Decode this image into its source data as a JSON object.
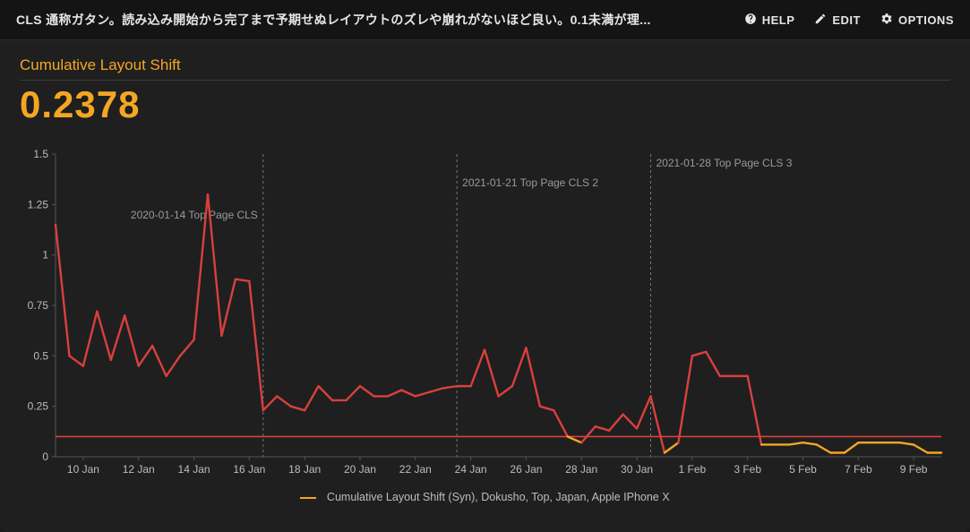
{
  "header": {
    "title_tag": "CLS",
    "title_rest": "通称ガタン。読み込み開始から完了まで予期せぬレイアウトのズレや崩れがないほど良い。0.1未満が理...",
    "help": "HELP",
    "edit": "EDIT",
    "options": "OPTIONS"
  },
  "metric": {
    "title": "Cumulative Layout Shift",
    "value": "0.2378"
  },
  "legend": {
    "series": "Cumulative Layout Shift (Syn), Dokusho, Top, Japan, Apple IPhone X"
  },
  "chart_data": {
    "type": "line",
    "title": "Cumulative Layout Shift",
    "xlabel": "",
    "ylabel": "",
    "ylim": [
      0,
      1.5
    ],
    "y_ticks": [
      0,
      0.25,
      0.5,
      0.75,
      1,
      1.25,
      1.5
    ],
    "x_ticks": [
      "10 Jan",
      "12 Jan",
      "14 Jan",
      "16 Jan",
      "18 Jan",
      "20 Jan",
      "22 Jan",
      "24 Jan",
      "26 Jan",
      "28 Jan",
      "30 Jan",
      "1 Feb",
      "3 Feb",
      "5 Feb",
      "7 Feb",
      "9 Feb"
    ],
    "threshold": 0.1,
    "annotations": [
      {
        "x": 7.5,
        "label": "2020-01-14 Top Page CLS"
      },
      {
        "x": 14.5,
        "label": "2021-01-21 Top Page CLS 2"
      },
      {
        "x": 21.5,
        "label": "2021-01-28 Top Page CLS 3"
      }
    ],
    "series": [
      {
        "name": "Cumulative Layout Shift (Syn), Dokusho, Top, Japan, Apple IPhone X",
        "color": "#f5a623",
        "over_color": "#d8403e",
        "x": [
          0,
          0.5,
          1,
          1.5,
          2,
          2.5,
          3,
          3.5,
          4,
          4.5,
          5,
          5.5,
          6,
          6.5,
          7,
          7.5,
          8,
          8.5,
          9,
          9.5,
          10,
          10.5,
          11,
          11.5,
          12,
          12.5,
          13,
          13.5,
          14,
          14.5,
          15,
          15.5,
          16,
          16.5,
          17,
          17.5,
          18,
          18.5,
          19,
          19.5,
          20,
          20.5,
          21,
          21.5,
          22,
          22.5,
          23,
          23.5,
          24,
          24.5,
          25,
          25.5,
          26,
          26.5,
          27,
          27.5,
          28,
          28.5,
          29,
          29.5,
          30,
          30.5,
          31,
          31.5,
          32
        ],
        "y": [
          1.15,
          0.5,
          0.45,
          0.72,
          0.48,
          0.7,
          0.45,
          0.55,
          0.4,
          0.5,
          0.58,
          1.3,
          0.6,
          0.88,
          0.87,
          0.23,
          0.3,
          0.25,
          0.23,
          0.35,
          0.28,
          0.28,
          0.35,
          0.3,
          0.3,
          0.33,
          0.3,
          0.32,
          0.34,
          0.35,
          0.35,
          0.53,
          0.3,
          0.35,
          0.54,
          0.25,
          0.23,
          0.1,
          0.07,
          0.15,
          0.13,
          0.21,
          0.14,
          0.3,
          0.02,
          0.07,
          0.5,
          0.52,
          0.4,
          0.4,
          0.4,
          0.06,
          0.06,
          0.06,
          0.07,
          0.06,
          0.02,
          0.02,
          0.07,
          0.07,
          0.07,
          0.07,
          0.06,
          0.02,
          0.02
        ]
      }
    ]
  }
}
